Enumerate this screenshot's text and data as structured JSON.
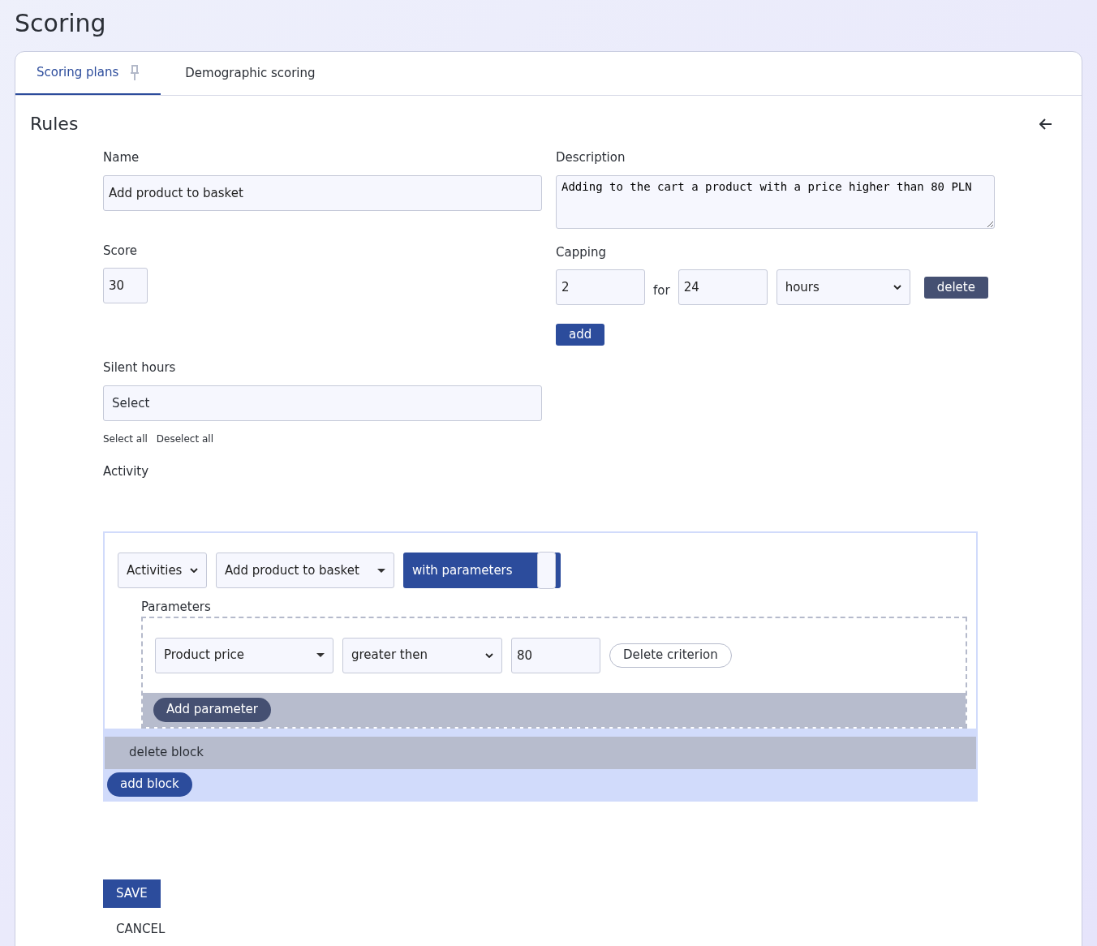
{
  "page_title": "Scoring",
  "tabs": [
    {
      "label": "Scoring plans",
      "selected": true,
      "pinned": true
    },
    {
      "label": "Demographic scoring",
      "selected": false,
      "pinned": false
    }
  ],
  "section_title": "Rules",
  "name": {
    "label": "Name",
    "value": "Add product to basket"
  },
  "description": {
    "label": "Description",
    "value": "Adding to the cart a product with a price higher than 80 PLN"
  },
  "score": {
    "label": "Score",
    "value": "30"
  },
  "capping": {
    "label": "Capping",
    "rows": [
      {
        "count": "2",
        "for": "for",
        "period": "24",
        "unit": "hours",
        "delete": "delete"
      }
    ],
    "add": "add"
  },
  "silent_hours": {
    "label": "Silent hours",
    "placeholder": "Select",
    "select_all": "Select all",
    "deselect_all": "Deselect all"
  },
  "activity": {
    "label": "Activity",
    "blocks": [
      {
        "type": "Activities",
        "activity": "Add product to basket",
        "toggle": {
          "label": "with parameters",
          "on": true
        },
        "parameters_label": "Parameters",
        "criteria": [
          {
            "parameter": "Product price",
            "operator": "greater then",
            "value": "80",
            "delete": "Delete criterion"
          }
        ],
        "add_parameter": "Add parameter",
        "delete_block": "delete block"
      }
    ],
    "add_block": "add block"
  },
  "save": "SAVE",
  "cancel": "CANCEL"
}
